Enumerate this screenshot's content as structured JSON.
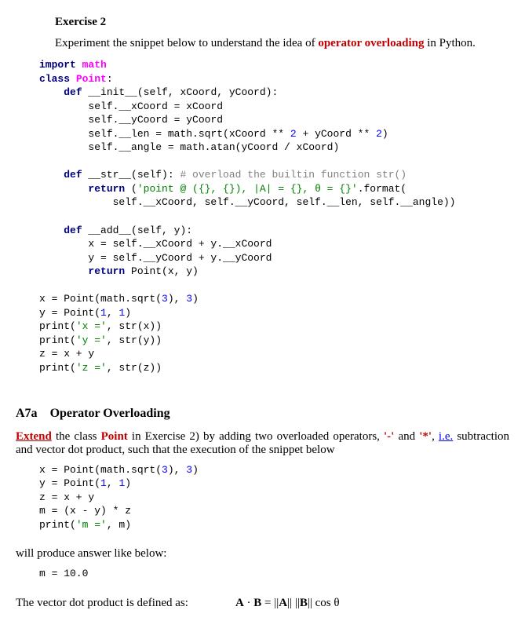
{
  "exercise": {
    "title": "Exercise 2",
    "instruction_pre": "Experiment the snippet below to understand the idea of ",
    "instruction_bold": "operator overloading",
    "instruction_post": " in Python."
  },
  "code1": {
    "l1_kw1": "import",
    "l1_mod": "math",
    "l2_kw1": "class",
    "l2_name": "Point",
    "l2_colon": ":",
    "l3_prefix": "    ",
    "l3_kw": "def",
    "l3_name": " __init__(self, xCoord, yCoord):",
    "l4": "        self.__xCoord = xCoord",
    "l5": "        self.__yCoord = yCoord",
    "l6_pre": "        self.__len = math.sqrt(xCoord ** ",
    "l6_n1": "2",
    "l6_mid": " + yCoord ** ",
    "l6_n2": "2",
    "l6_post": ")",
    "l7": "        self.__angle = math.atan(yCoord / xCoord)",
    "l8": "",
    "l9_prefix": "    ",
    "l9_kw": "def",
    "l9_name": " __str__(self): ",
    "l9_comment": "# overload the builtin function str()",
    "l10_prefix": "        ",
    "l10_kw": "return",
    "l10_rest": " (",
    "l10_str": "'point @ ({}, {}), |A| = {}, θ = {}'",
    "l10_end": ".format(",
    "l11": "            self.__xCoord, self.__yCoord, self.__len, self.__angle))",
    "l12": "",
    "l13_prefix": "    ",
    "l13_kw": "def",
    "l13_name": " __add__(self, y):",
    "l14": "        x = self.__xCoord + y.__xCoord",
    "l15": "        y = self.__yCoord + y.__yCoord",
    "l16_prefix": "        ",
    "l16_kw": "return",
    "l16_rest": " Point(x, y)",
    "l17": "",
    "l18_pre": "x = Point(math.sqrt(",
    "l18_n1": "3",
    "l18_mid": "), ",
    "l18_n2": "3",
    "l18_post": ")",
    "l19_pre": "y = Point(",
    "l19_n1": "1",
    "l19_mid": ", ",
    "l19_n2": "1",
    "l19_post": ")",
    "l20_pre": "print(",
    "l20_str": "'x ='",
    "l20_post": ", str(x))",
    "l21_pre": "print(",
    "l21_str": "'y ='",
    "l21_post": ", str(y))",
    "l22": "z = x + y",
    "l23_pre": "print(",
    "l23_str": "'z ='",
    "l23_post": ", str(z))"
  },
  "section": {
    "heading_num": "A7a",
    "heading_title": "Operator Overloading"
  },
  "extend": {
    "word_extend": "Extend",
    "text1": " the class ",
    "point": "Point",
    "text2": " in Exercise 2) by adding two overloaded operators, ",
    "op1": "'-'",
    "text3": " and ",
    "op2": "'*'",
    "text4": ", ",
    "ie": "i.e.",
    "text5": " subtraction and vector dot product, such that the execution of the snippet below"
  },
  "code2": {
    "l1_pre": "x = Point(math.sqrt(",
    "l1_n1": "3",
    "l1_mid": "), ",
    "l1_n2": "3",
    "l1_post": ")",
    "l2_pre": "y = Point(",
    "l2_n1": "1",
    "l2_mid": ", ",
    "l2_n2": "1",
    "l2_post": ")",
    "l3": "z = x + y",
    "l4": "m = (x - y) * z",
    "l5_pre": "print(",
    "l5_str": "'m ='",
    "l5_post": ", m)"
  },
  "result": {
    "intro": "will produce answer like below:",
    "output": "m = 10.0"
  },
  "formula": {
    "intro": "The vector dot product is defined as:",
    "A": "A",
    "dot": " · ",
    "B": "B",
    "eq": " = ||",
    "A2": "A",
    "mid": "|| ||",
    "B2": "B",
    "end": "|| cos θ"
  }
}
